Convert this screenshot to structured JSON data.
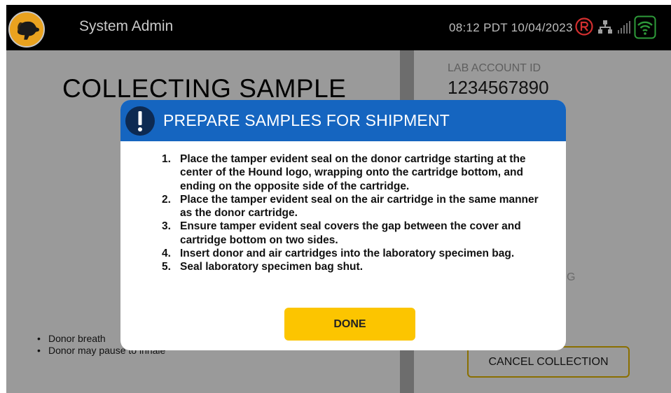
{
  "header": {
    "user_name": "System Admin",
    "datetime": "08:12 PDT 10/04/2023",
    "icons": [
      "logo-icon",
      "registered-icon",
      "network-icon",
      "signal-icon",
      "wifi-icon"
    ],
    "registered_color": "#d32f2f",
    "wifi_color": "#2e9b3a"
  },
  "main": {
    "title": "COLLECTING SAMPLE",
    "bullets": [
      "Donor breath",
      "Donor may pause to inhale"
    ]
  },
  "side": {
    "lab_account_label": "LAB ACCOUNT ID",
    "lab_account_id": "1234567890",
    "partial_text": "G",
    "cancel_label": "CANCEL COLLECTION"
  },
  "modal": {
    "title": "PREPARE SAMPLES FOR SHIPMENT",
    "header_color": "#1565c0",
    "icon": "exclamation-icon",
    "steps": [
      {
        "num": "1.",
        "text": "Place the tamper evident seal on the donor cartridge starting at the center of the Hound logo, wrapping onto the cartridge bottom, and ending on the opposite side of the cartridge."
      },
      {
        "num": "2.",
        "text": "Place the tamper evident seal on the air cartridge in the same manner as the donor cartridge."
      },
      {
        "num": "3.",
        "text": "Ensure tamper evident seal covers the gap between the cover and cartridge bottom on two sides."
      },
      {
        "num": "4.",
        "text": "Insert donor and air cartridges into the laboratory specimen bag."
      },
      {
        "num": "5.",
        "text": "Seal laboratory specimen bag shut."
      }
    ],
    "done_label": "DONE",
    "done_color": "#fcc500"
  }
}
